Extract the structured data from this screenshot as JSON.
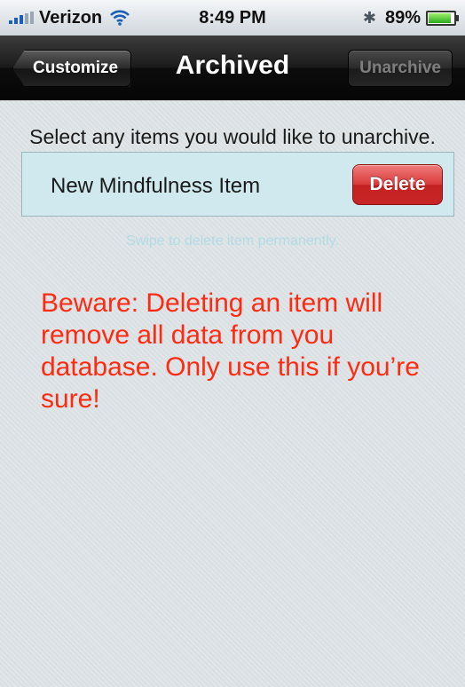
{
  "status_bar": {
    "carrier": "Verizon",
    "time": "8:49 PM",
    "battery_text": "89%",
    "battery_level": 0.89,
    "bluetooth_icon": "bluetooth-icon",
    "wifi_icon": "wifi-icon"
  },
  "nav": {
    "title": "Archived",
    "back_label": "Customize",
    "action_label": "Unarchive"
  },
  "content": {
    "instruction": "Select any items you would like to unarchive.",
    "items": [
      {
        "label": "New Mindfulness Item",
        "delete_label": "Delete"
      }
    ],
    "hint": "Swipe to delete item permanently.",
    "warning": "Beware: Deleting an item will remove all data from you database. Only use this if you’re sure!"
  },
  "colors": {
    "warning_text": "#ff2a10",
    "delete_button": "#d93a3a",
    "item_background": "#cfe9ef"
  }
}
